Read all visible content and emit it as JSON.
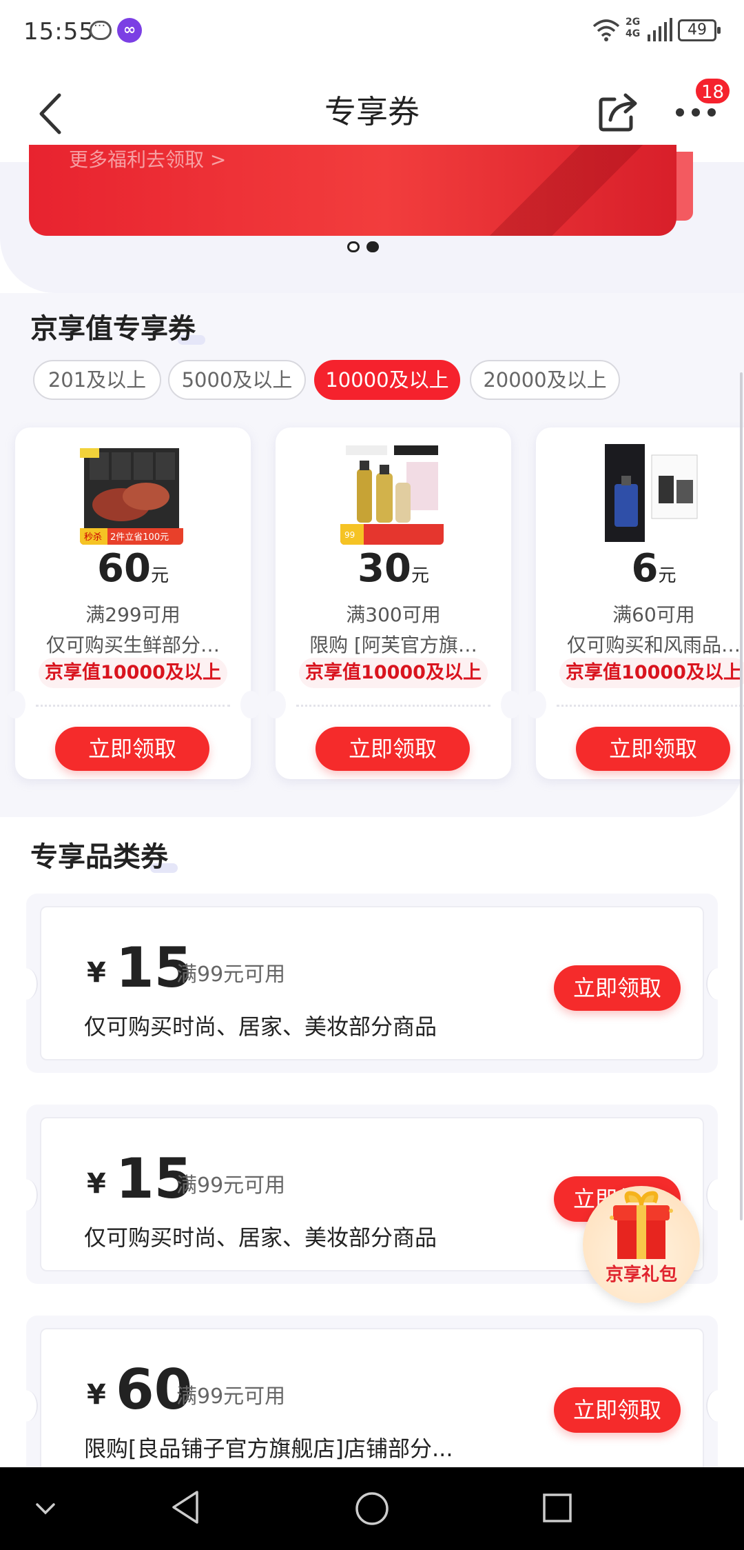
{
  "status_bar": {
    "time": "15:55",
    "network": "2G\n4G",
    "battery": "49"
  },
  "header": {
    "title": "专享券",
    "badge_count": "18"
  },
  "banner": {
    "text": "更多福利去领取 >"
  },
  "jingxiang_section": {
    "title": "京享值专享券",
    "chips": [
      {
        "label": "201及以上",
        "active": false
      },
      {
        "label": "5000及以上",
        "active": false
      },
      {
        "label": "10000及以上",
        "active": true
      },
      {
        "label": "20000及以上",
        "active": false
      }
    ],
    "cards": [
      {
        "amount": "60",
        "unit": "元",
        "condition": "满299可用",
        "scope": "仅可购买生鲜部分…",
        "tag": "京享值10000及以上",
        "button": "立即领取",
        "image": "steak-product"
      },
      {
        "amount": "30",
        "unit": "元",
        "condition": "满300可用",
        "scope": "限购 [阿芙官方旗…",
        "tag": "京享值10000及以上",
        "button": "立即领取",
        "image": "oil-product"
      },
      {
        "amount": "6",
        "unit": "元",
        "condition": "满60可用",
        "scope": "仅可购买和风雨品…",
        "tag": "京享值10000及以上",
        "button": "立即领取",
        "image": "perfume-product"
      }
    ]
  },
  "category_section": {
    "title": "专享品类券",
    "coupons": [
      {
        "currency": "¥",
        "amount": "15",
        "condition": "满99元可用",
        "scope": "仅可购买时尚、居家、美妆部分商品",
        "button": "立即领取"
      },
      {
        "currency": "¥",
        "amount": "15",
        "condition": "满99元可用",
        "scope": "仅可购买时尚、居家、美妆部分商品",
        "button": "立即领取"
      },
      {
        "currency": "¥",
        "amount": "60",
        "condition": "满99元可用",
        "scope": "限购[良品铺子官方旗舰店]店铺部分...",
        "button": "立即领取"
      }
    ]
  },
  "floating_gift": {
    "label": "京享礼包"
  },
  "colors": {
    "accent": "#f52b2b",
    "tag_text": "#d9141e",
    "section_bg": "#f6f6fb"
  }
}
